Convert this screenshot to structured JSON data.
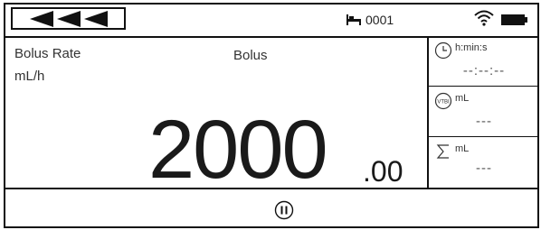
{
  "status_bar": {
    "bed_number": "0001"
  },
  "main": {
    "rate_label": "Bolus Rate",
    "rate_unit": "mL/h",
    "mode_label": "Bolus",
    "value_integer": "2000",
    "value_decimal": ".00"
  },
  "side_panel": {
    "time": {
      "unit": "h:min:s",
      "value": "--:--:--"
    },
    "vtbi": {
      "unit": "mL",
      "value": "---"
    },
    "total": {
      "unit": "mL",
      "value": "---"
    }
  },
  "icons": {
    "back": "triple-left-arrow-icon",
    "bed": "bed-icon",
    "wifi": "wifi-icon",
    "battery": "battery-icon",
    "clock": "clock-icon",
    "vtbi": "vtbi-icon",
    "sum": "sigma-icon",
    "pause": "pause-icon"
  }
}
